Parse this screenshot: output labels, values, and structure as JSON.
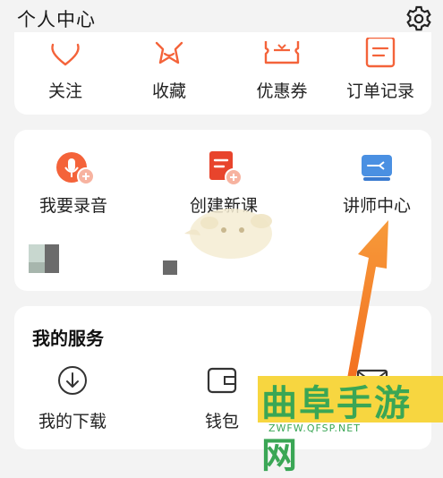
{
  "header": {
    "title": "个人中心"
  },
  "quick_row": [
    {
      "label": "关注"
    },
    {
      "label": "收藏"
    },
    {
      "label": "优惠券"
    },
    {
      "label": "订单记录"
    }
  ],
  "tools_row": [
    {
      "label": "我要录音"
    },
    {
      "label": "创建新课"
    },
    {
      "label": "讲师中心"
    }
  ],
  "services": {
    "title": "我的服务",
    "items": [
      {
        "label": "我的下载"
      },
      {
        "label": "钱包"
      },
      {
        "label": ""
      }
    ]
  },
  "watermark": {
    "main": "曲阜手游网",
    "sub": "ZWFW.QFSP.NET"
  },
  "colors": {
    "accent": "#f4633a",
    "blue": "#4a90e2",
    "arrow": "#f57a1f",
    "watermark": "#3aa655"
  }
}
